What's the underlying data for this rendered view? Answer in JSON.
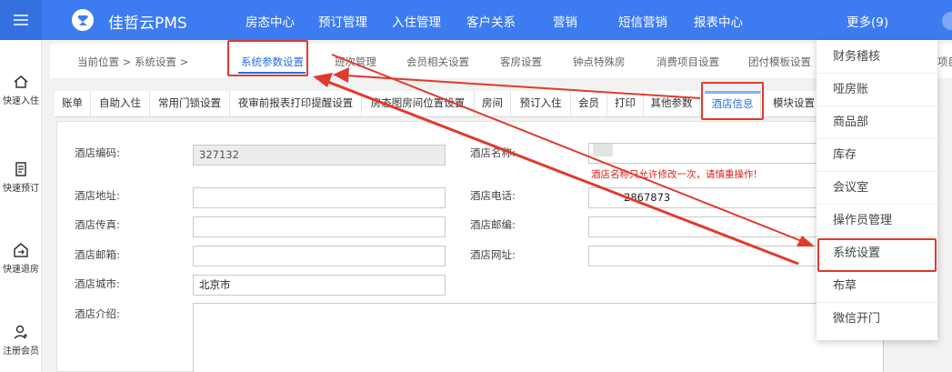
{
  "brand": "佳哲云PMS",
  "nav": [
    "房态中心",
    "预订管理",
    "入住管理",
    "客户关系",
    "营销",
    "短信营销",
    "报表中心",
    "更多(9)"
  ],
  "sidebar": [
    "快速入住",
    "快速预订",
    "快速退房",
    "注册会员"
  ],
  "breadcrumb": "当前位置 > 系统设置 >",
  "tabs1": [
    "系统参数设置",
    "班次管理",
    "会员相关设置",
    "客房设置",
    "钟点特殊房",
    "消费项目设置",
    "团付模板设置",
    "项目"
  ],
  "tabs2": [
    "账单",
    "自助入住",
    "常用门锁设置",
    "夜审前报表打印提醒设置",
    "房态图房间位置设置",
    "房间",
    "预订入住",
    "会员",
    "打印",
    "其他参数",
    "酒店信息",
    "模块设置"
  ],
  "form": {
    "code_label": "酒店编码:",
    "code_value": "327132",
    "name_label": "酒店名称:",
    "name_warning": "酒店名称只允许修改一次，请慎重操作!",
    "address_label": "酒店地址:",
    "phone_label": "酒店电话:",
    "phone_value": "2867873",
    "fax_label": "酒店传真:",
    "postcode_label": "酒店邮编:",
    "email_label": "酒店邮箱:",
    "website_label": "酒店网址:",
    "city_label": "酒店城市:",
    "city_value": "北京市",
    "intro_label": "酒店介绍:"
  },
  "dropdown": [
    "财务稽核",
    "哑房账",
    "商品部",
    "库存",
    "会议室",
    "操作员管理",
    "系统设置",
    "布草",
    "微信开门"
  ],
  "colors": {
    "topbar": "#3d7cf0",
    "accent": "#2a6ddf",
    "highlight": "#e03a2e"
  }
}
